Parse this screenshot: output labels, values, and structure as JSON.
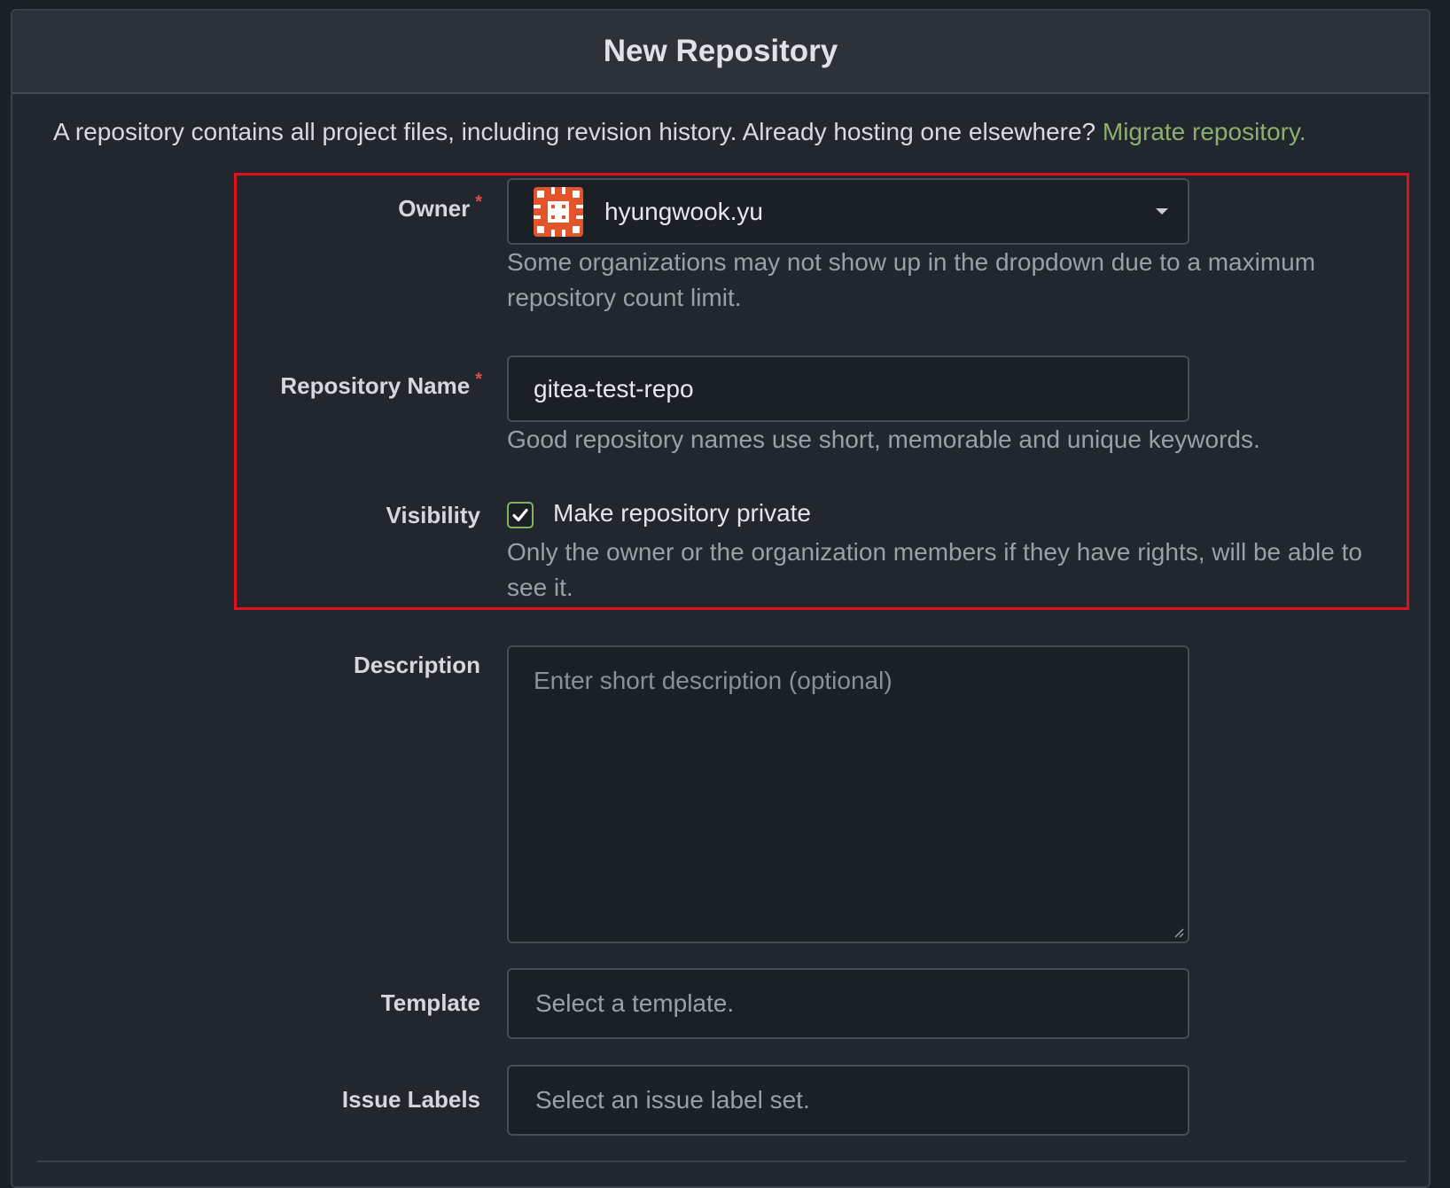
{
  "dialog": {
    "title": "New Repository"
  },
  "intro": {
    "text": "A repository contains all project files, including revision history. Already hosting one elsewhere?",
    "link": "Migrate repository."
  },
  "owner": {
    "label": "Owner",
    "required_mark": "*",
    "value": "hyungwook.yu",
    "avatar_icon": "identicon-avatar",
    "help": "Some organizations may not show up in the dropdown due to a maximum repository count limit."
  },
  "repo_name": {
    "label": "Repository Name",
    "required_mark": "*",
    "value": "gitea-test-repo",
    "help": "Good repository names use short, memorable and unique keywords."
  },
  "visibility": {
    "label": "Visibility",
    "checked": true,
    "checkbox_label": "Make repository private",
    "help": "Only the owner or the organization members if they have rights, will be able to see it."
  },
  "description": {
    "label": "Description",
    "placeholder": "Enter short description (optional)"
  },
  "template": {
    "label": "Template",
    "placeholder": "Select a template."
  },
  "issue_labels": {
    "label": "Issue Labels",
    "placeholder": "Select an issue label set."
  },
  "colors": {
    "link": "#8cb06b",
    "highlight": "#e0101c",
    "required": "#d9503f",
    "checkbox": "#7fb35c"
  }
}
